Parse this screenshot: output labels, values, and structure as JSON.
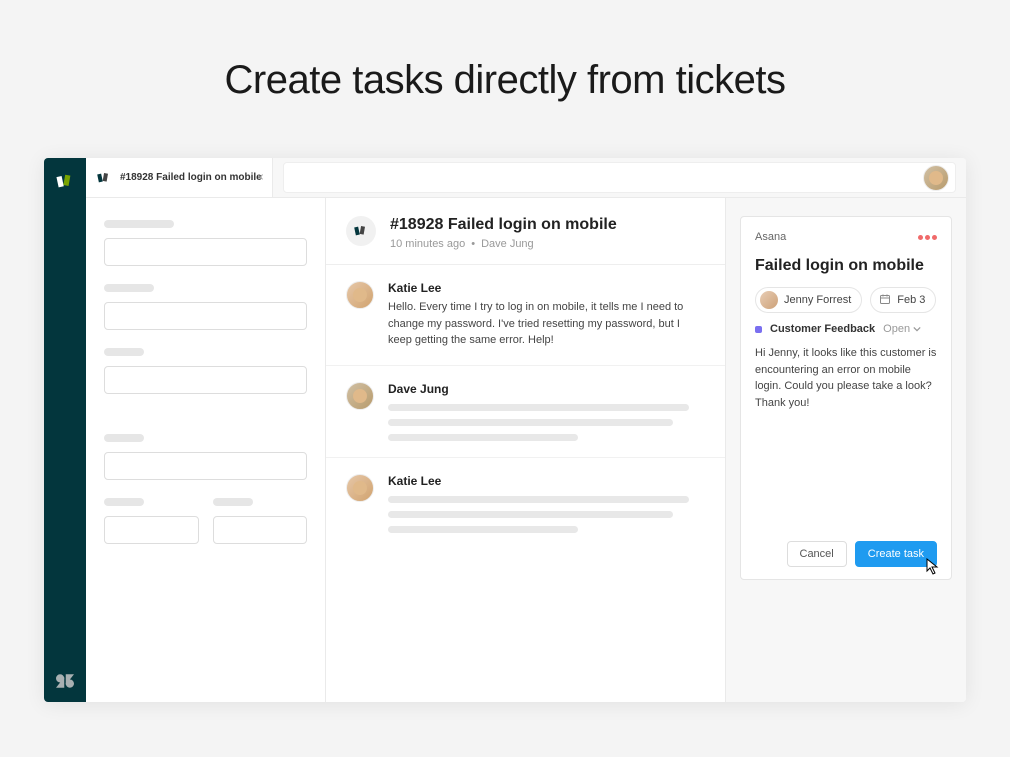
{
  "page": {
    "heading": "Create tasks directly from tickets"
  },
  "tab": {
    "title": "#18928 Failed login on mobile"
  },
  "ticket": {
    "title": "#18928 Failed login on mobile",
    "time": "10 minutes ago",
    "author": "Dave Jung"
  },
  "messages": [
    {
      "name": "Katie Lee",
      "text": "Hello. Every time I try to log in on mobile, it tells me I need to change my password. I've tried resetting my password, but I keep getting the same error. Help!"
    },
    {
      "name": "Dave Jung",
      "text": ""
    },
    {
      "name": "Katie Lee",
      "text": ""
    }
  ],
  "asana": {
    "brand": "Asana",
    "title": "Failed login on mobile",
    "assignee": "Jenny Forrest",
    "due": "Feb 3",
    "project": "Customer Feedback",
    "status": "Open",
    "description": "Hi Jenny, it looks like this customer is encountering an error on mobile login. Could you please take a look? Thank you!",
    "cancel": "Cancel",
    "create": "Create task"
  }
}
